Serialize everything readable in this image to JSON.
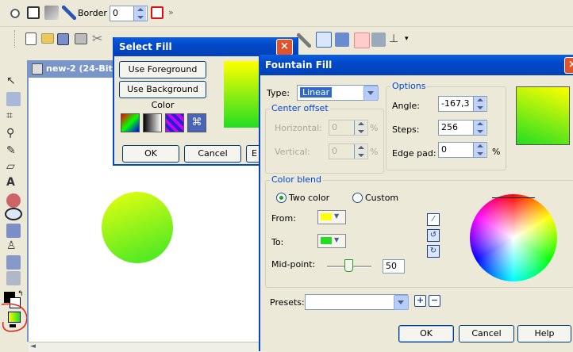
{
  "toolbar": {
    "border_label": "Border",
    "border_value": "0"
  },
  "document_tab": {
    "title": "new-2 (24-Bit"
  },
  "select_fill": {
    "title": "Select Fill",
    "use_foreground": "Use Foreground Color",
    "use_background": "Use Background Color",
    "ok": "OK",
    "cancel": "Cancel",
    "edit_partial": "E"
  },
  "fountain_fill": {
    "title": "Fountain Fill",
    "type_label": "Type:",
    "type_value": "Linear",
    "center_offset": {
      "title": "Center offset",
      "horizontal_label": "Horizontal:",
      "horizontal_value": "0",
      "vertical_label": "Vertical:",
      "vertical_value": "0",
      "unit": "%"
    },
    "options": {
      "title": "Options",
      "angle_label": "Angle:",
      "angle_value": "-167,3",
      "steps_label": "Steps:",
      "steps_value": "256",
      "edge_pad_label": "Edge pad:",
      "edge_pad_value": "0",
      "edge_pad_unit": "%"
    },
    "color_blend": {
      "title": "Color blend",
      "two_color": "Two color",
      "custom": "Custom",
      "from_label": "From:",
      "from_color": "#ffff00",
      "to_label": "To:",
      "to_color": "#22dd22",
      "midpoint_label": "Mid-point:",
      "midpoint_value": "50"
    },
    "presets_label": "Presets:",
    "presets_value": "",
    "ok": "OK",
    "cancel": "Cancel",
    "help": "Help"
  },
  "colors": {
    "accent": "#0348c8",
    "fill_start": "#ffff00",
    "fill_end": "#22dd22"
  }
}
